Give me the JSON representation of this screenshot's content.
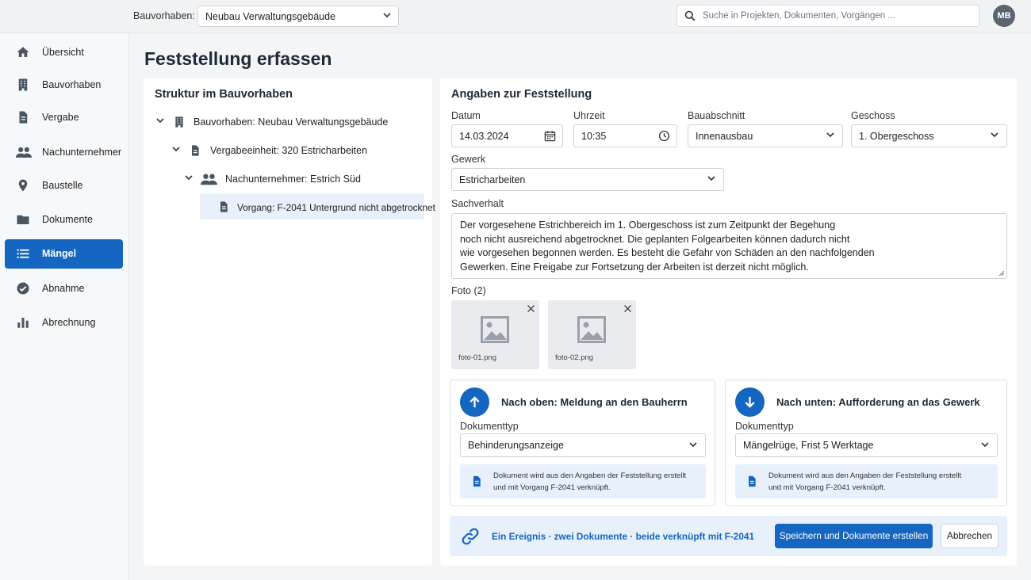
{
  "header": {
    "project_label": "Bauvorhaben:",
    "project_value": "Neubau Verwaltungsgebäude",
    "search_placeholder": "Suche in Projekten, Dokumenten, Vorgängen ...",
    "avatar_initials": "MB"
  },
  "sidebar": {
    "items": [
      {
        "label": "Übersicht",
        "icon": "home-icon"
      },
      {
        "label": "Bauvorhaben",
        "icon": "building-icon"
      },
      {
        "label": "Vergabe",
        "icon": "document-icon"
      },
      {
        "label": "Nachunternehmer",
        "icon": "people-icon"
      },
      {
        "label": "Baustelle",
        "icon": "location-pin-icon"
      },
      {
        "label": "Dokumente",
        "icon": "folder-icon"
      },
      {
        "label": "Mängel",
        "icon": "list-icon",
        "active": true
      },
      {
        "label": "Abnahme",
        "icon": "check-circle-icon"
      },
      {
        "label": "Abrechnung",
        "icon": "bar-chart-icon"
      }
    ]
  },
  "page": {
    "title": "Feststellung erfassen"
  },
  "structure": {
    "title": "Struktur im Bauvorhaben",
    "nodes": [
      {
        "label": "Bauvorhaben: Neubau Verwaltungsgebäude",
        "icon": "building-icon"
      },
      {
        "label": "Vergabeeinheit: 320 Estricharbeiten",
        "icon": "document-icon"
      },
      {
        "label": "Nachunternehmer: Estrich Süd",
        "icon": "people-icon"
      },
      {
        "label": "Vorgang: F-2041 Untergrund nicht abgetrocknet",
        "icon": "document-icon",
        "selected": true
      }
    ]
  },
  "form": {
    "title": "Angaben zur Feststellung",
    "datum": {
      "label": "Datum",
      "value": "14.03.2024"
    },
    "uhrzeit": {
      "label": "Uhrzeit",
      "value": "10:35"
    },
    "bauabschnitt": {
      "label": "Bauabschnitt",
      "value": "Innenausbau"
    },
    "geschoss": {
      "label": "Geschoss",
      "value": "1. Obergeschoss"
    },
    "gewerk": {
      "label": "Gewerk",
      "value": "Estricharbeiten"
    },
    "sachverhalt": {
      "label": "Sachverhalt",
      "lines": [
        "Der vorgesehene Estrichbereich im 1. Obergeschoss ist zum Zeitpunkt der Begehung",
        "noch nicht ausreichend abgetrocknet. Die geplanten Folgearbeiten können dadurch nicht",
        "wie vorgesehen begonnen werden. Es besteht die Gefahr von Schäden an den nachfolgenden",
        "Gewerken. Eine Freigabe zur Fortsetzung der Arbeiten ist derzeit nicht möglich."
      ]
    },
    "photos": {
      "label": "Foto (2)",
      "files": [
        "foto-01.png",
        "foto-02.png"
      ]
    }
  },
  "cards": {
    "up": {
      "title": "Nach oben: Meldung an den Bauherrn",
      "doc_label": "Dokumenttyp",
      "doc_value": "Behinderungsanzeige",
      "info_line1": "Dokument wird aus den Angaben der Feststellung erstellt",
      "info_line2": "und mit Vorgang F-2041 verknüpft."
    },
    "down": {
      "title": "Nach unten: Aufforderung an das Gewerk",
      "doc_label": "Dokumenttyp",
      "doc_value": "Mängelrüge, Frist 5 Werktage",
      "info_line1": "Dokument wird aus den Angaben der Feststellung erstellt",
      "info_line2": "und mit Vorgang F-2041 verknüpft."
    }
  },
  "footer": {
    "summary": "Ein Ereignis · zwei Dokumente · beide verknüpft mit F-2041",
    "save_label": "Speichern und Dokumente erstellen",
    "cancel_label": "Abbrechen"
  },
  "colors": {
    "accent": "#1466c0",
    "info_bg": "#e7f0fb",
    "icon_gray": "#4a5560"
  }
}
